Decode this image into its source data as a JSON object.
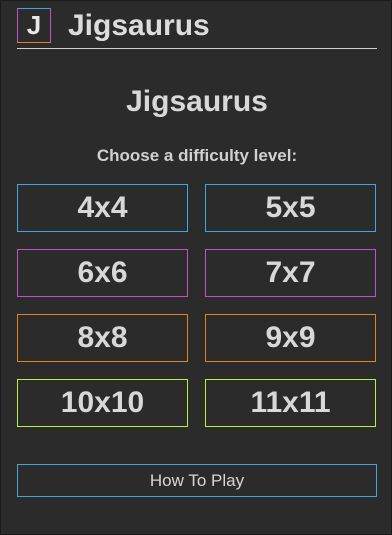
{
  "header": {
    "logo_letter": "J",
    "app_title": "Jigsaurus"
  },
  "main": {
    "title": "Jigsaurus",
    "subtitle": "Choose a difficulty level:"
  },
  "levels": [
    {
      "label": "4x4",
      "color": "#3ea6e0"
    },
    {
      "label": "5x5",
      "color": "#3ea6e0"
    },
    {
      "label": "6x6",
      "color": "#c64fc6"
    },
    {
      "label": "7x7",
      "color": "#c64fc6"
    },
    {
      "label": "8x8",
      "color": "#e6811c"
    },
    {
      "label": "9x9",
      "color": "#e6811c"
    },
    {
      "label": "10x10",
      "color": "#b6f03a"
    },
    {
      "label": "11x11",
      "color": "#b6f03a"
    }
  ],
  "footer": {
    "how_to_play_label": "How To Play"
  },
  "colors": {
    "background": "#2b2b2b",
    "blue": "#3ea6e0",
    "magenta": "#c64fc6",
    "orange": "#e6811c",
    "lime": "#b6f03a",
    "text": "#d8d8d8"
  }
}
